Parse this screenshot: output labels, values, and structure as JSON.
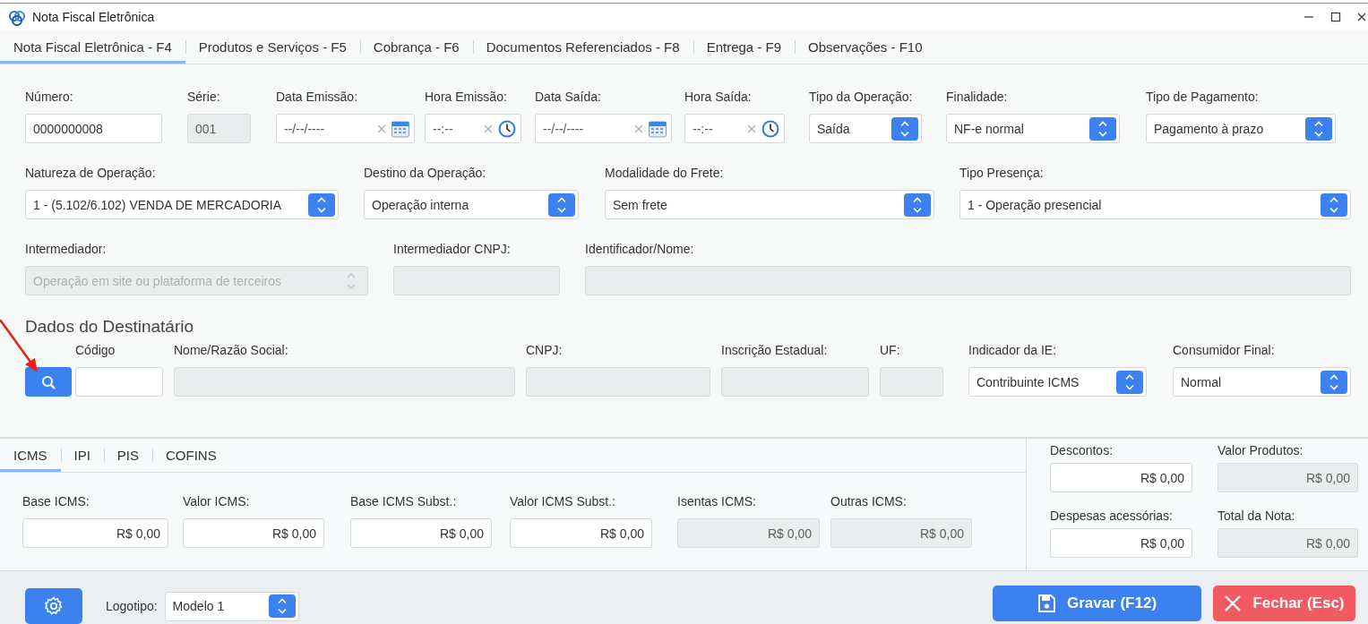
{
  "window": {
    "title": "Nota Fiscal Eletrônica"
  },
  "tabs": [
    {
      "label": "Nota Fiscal Eletrônica - F4",
      "selected": true
    },
    {
      "label": "Produtos e Serviços - F5",
      "selected": false
    },
    {
      "label": "Cobrança - F6",
      "selected": false
    },
    {
      "label": "Documentos Referenciados - F8",
      "selected": false
    },
    {
      "label": "Entrega - F9",
      "selected": false
    },
    {
      "label": "Observações - F10",
      "selected": false
    }
  ],
  "form_rows": [
    [
      {
        "label": "Número:",
        "kind": "text",
        "value": "0000000008",
        "disabled": false
      },
      {
        "label": "Série:",
        "kind": "text",
        "value": "001",
        "disabled": true
      },
      {
        "label": "Data Emissão:",
        "kind": "date",
        "placeholder": "--/--/----",
        "disabled": false
      },
      {
        "label": "Hora Emissão:",
        "kind": "time",
        "placeholder": "--:--",
        "disabled": false
      },
      {
        "label": "Data Saída:",
        "kind": "date",
        "placeholder": "--/--/----",
        "disabled": false
      },
      {
        "label": "Hora Saída:",
        "kind": "time",
        "placeholder": "--:--",
        "disabled": false
      },
      {
        "label": "Tipo da Operação:",
        "kind": "select",
        "value": "Saída",
        "disabled": false
      },
      {
        "label": "Finalidade:",
        "kind": "select",
        "value": "NF-e normal",
        "disabled": false
      },
      {
        "label": "Tipo de Pagamento:",
        "kind": "select",
        "value": "Pagamento à prazo",
        "disabled": false
      }
    ],
    [
      {
        "label": "Natureza de Operação:",
        "kind": "select",
        "value": "1 - (5.102/6.102) VENDA DE MERCADORIA",
        "disabled": false
      },
      {
        "label": "Destino da Operação:",
        "kind": "select",
        "value": "Operação interna",
        "disabled": false
      },
      {
        "label": "Modalidade do Frete:",
        "kind": "select",
        "value": "Sem frete",
        "disabled": false
      },
      {
        "label": "Tipo Presença:",
        "kind": "select",
        "value": "1 - Operação presencial",
        "disabled": false
      }
    ],
    [
      {
        "label": "Intermediador:",
        "kind": "select",
        "value": "Operação em site ou plataforma de terceiros",
        "disabled": true
      },
      {
        "label": "Intermediador CNPJ:",
        "kind": "text",
        "disabled": true
      },
      {
        "label": "Identificador/Nome:",
        "kind": "text",
        "disabled": true
      }
    ]
  ],
  "recipient": {
    "title": "Dados do Destinatário",
    "fields": [
      {
        "kind": "search"
      },
      {
        "label": "Código",
        "kind": "text",
        "disabled": false
      },
      {
        "label": "Nome/Razão Social:",
        "kind": "text",
        "disabled": true
      },
      {
        "label": "CNPJ:",
        "kind": "text",
        "disabled": true
      },
      {
        "label": "Inscrição Estadual:",
        "kind": "text",
        "disabled": true
      },
      {
        "label": "UF:",
        "kind": "text",
        "disabled": true
      },
      {
        "label": "Indicador da IE:",
        "kind": "select",
        "value": "Contribuinte ICMS",
        "disabled": false
      },
      {
        "label": "Consumidor Final:",
        "kind": "select",
        "value": "Normal",
        "disabled": false
      }
    ]
  },
  "tax_tabs": [
    {
      "label": "ICMS",
      "selected": true
    },
    {
      "label": "IPI",
      "selected": false
    },
    {
      "label": "PIS",
      "selected": false
    },
    {
      "label": "COFINS",
      "selected": false
    }
  ],
  "tax_fields": [
    {
      "label": "Base ICMS:",
      "kind": "money",
      "value": "R$ 0,00",
      "disabled": false
    },
    {
      "label": "Valor ICMS:",
      "kind": "money",
      "value": "R$ 0,00",
      "disabled": false
    },
    {
      "label": "Base ICMS Subst.:",
      "kind": "money",
      "value": "R$ 0,00",
      "disabled": false
    },
    {
      "label": "Valor ICMS Subst.:",
      "kind": "money",
      "value": "R$ 0,00",
      "disabled": false
    },
    {
      "label": "Isentas ICMS:",
      "kind": "money",
      "value": "R$ 0,00",
      "disabled": true
    },
    {
      "label": "Outras ICMS:",
      "kind": "money",
      "value": "R$ 0,00",
      "disabled": true
    }
  ],
  "summary_fields": [
    {
      "label": "Descontos:",
      "kind": "money",
      "value": "R$ 0,00",
      "disabled": false
    },
    {
      "label": "Valor Produtos:",
      "kind": "money",
      "value": "R$ 0,00",
      "disabled": true
    },
    {
      "label": "Despesas acessórias:",
      "kind": "money",
      "value": "R$ 0,00",
      "disabled": false
    },
    {
      "label": "Total da Nota:",
      "kind": "money",
      "value": "R$ 0,00",
      "disabled": true
    }
  ],
  "footer": {
    "logo": {
      "label": "Logotipo:",
      "kind": "select",
      "value": "Modelo 1",
      "disabled": false
    },
    "buttons": [
      {
        "label": "Gravar (F12)",
        "kind": "save"
      },
      {
        "label": "Fechar (Esc)",
        "kind": "close"
      }
    ]
  }
}
